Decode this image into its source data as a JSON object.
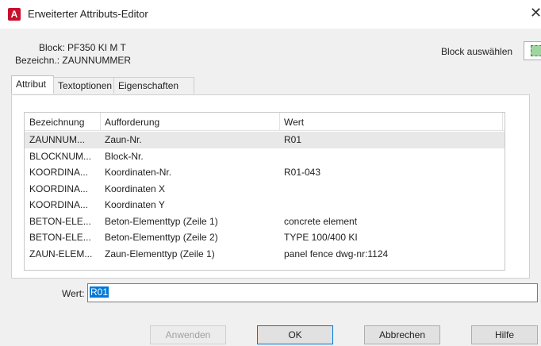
{
  "window": {
    "title": "Erweiterter Attributs-Editor",
    "app_icon_letter": "A",
    "close_glyph": "✕"
  },
  "block_info": {
    "block_label": "Block:",
    "block_value": "PF350 KI M T",
    "bezeichnung_label": "Bezeichn.:",
    "bezeichnung_value": "ZAUNNUMMER"
  },
  "block_select": {
    "label": "Block auswählen",
    "icon": "select-objects-icon"
  },
  "tabs": [
    {
      "label": "Attribut",
      "active": true
    },
    {
      "label": "Textoptionen",
      "active": false
    },
    {
      "label": "Eigenschaften",
      "active": false
    }
  ],
  "attribute_table": {
    "headers": [
      "Bezeichnung",
      "Aufforderung",
      "Wert"
    ],
    "rows": [
      {
        "tag": "ZAUNNUM...",
        "prompt": "Zaun-Nr.",
        "value": "R01",
        "selected": true
      },
      {
        "tag": "BLOCKNUM...",
        "prompt": "Block-Nr.",
        "value": ""
      },
      {
        "tag": "KOORDINA...",
        "prompt": "Koordinaten-Nr.",
        "value": "R01-043"
      },
      {
        "tag": "KOORDINA...",
        "prompt": "Koordinaten X",
        "value": ""
      },
      {
        "tag": "KOORDINA...",
        "prompt": "Koordinaten Y",
        "value": ""
      },
      {
        "tag": "BETON-ELE...",
        "prompt": "Beton-Elementtyp (Zeile 1)",
        "value": "concrete element"
      },
      {
        "tag": "BETON-ELE...",
        "prompt": "Beton-Elementtyp (Zeile 2)",
        "value": "TYPE 100/400 KI"
      },
      {
        "tag": "ZAUN-ELEM...",
        "prompt": "Zaun-Elementtyp (Zeile 1)",
        "value": "panel fence dwg-nr:1124"
      }
    ]
  },
  "value_field": {
    "label": "Wert:",
    "value": "R01"
  },
  "buttons": {
    "apply": "Anwenden",
    "ok": "OK",
    "cancel": "Abbrechen",
    "help": "Hilfe"
  }
}
